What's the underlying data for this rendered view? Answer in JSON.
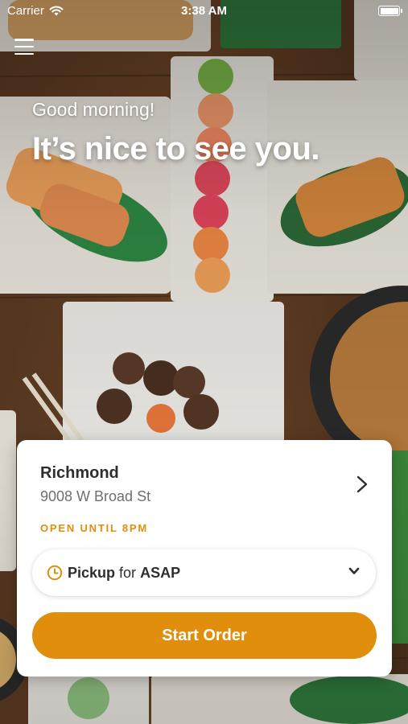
{
  "status_bar": {
    "carrier": "Carrier",
    "time": "3:38 AM"
  },
  "greeting": {
    "small": "Good morning!",
    "large": "It’s nice to see you."
  },
  "location": {
    "name": "Richmond",
    "address": "9008 W Broad St",
    "hours": "OPEN UNTIL 8PM"
  },
  "order_type": {
    "mode": "Pickup",
    "connector": "for",
    "time": "ASAP"
  },
  "actions": {
    "start_order_label": "Start Order"
  },
  "colors": {
    "accent": "#e08e0b",
    "card": "#ffffff",
    "text_primary": "#2e2e2e",
    "text_secondary": "#6f6f6f"
  },
  "icons": {
    "menu": "hamburger-menu-icon",
    "store_chevron": "chevron-right-icon",
    "clock": "clock-icon",
    "dropdown": "chevron-down-icon"
  }
}
